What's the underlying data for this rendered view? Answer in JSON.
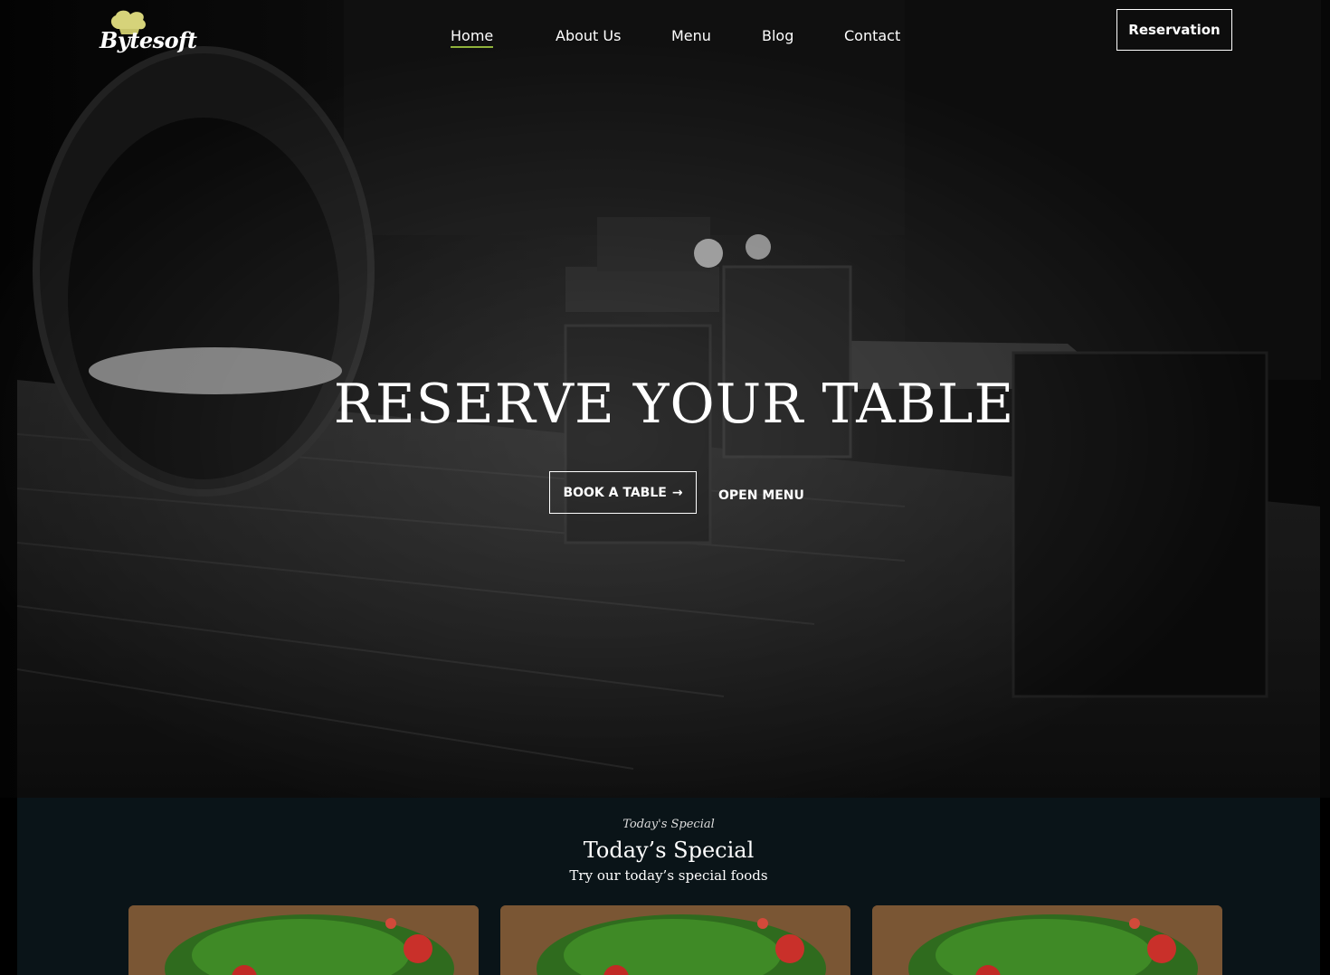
{
  "brand": {
    "logo_text": "Bytesoft",
    "logo_icon": "chef-hat-icon",
    "accent_color": "#8fb23a"
  },
  "nav": {
    "items": [
      {
        "label": "Home",
        "active": true
      },
      {
        "label": "About Us",
        "active": false
      },
      {
        "label": "Menu",
        "active": false
      },
      {
        "label": "Blog",
        "active": false
      },
      {
        "label": "Contact",
        "active": false
      }
    ],
    "reservation_label": "Reservation"
  },
  "hero": {
    "title": "RESERVE YOUR TABLE",
    "book_label": "BOOK A TABLE",
    "book_arrow": "→",
    "open_menu_label": "OPEN MENU"
  },
  "special": {
    "script_label": "Today's Special",
    "title": "Today’s Special",
    "subtitle": "Try our today’s special foods"
  },
  "cards": [
    {
      "image": "salad-food-image"
    },
    {
      "image": "salad-food-image"
    },
    {
      "image": "salad-food-image"
    }
  ]
}
